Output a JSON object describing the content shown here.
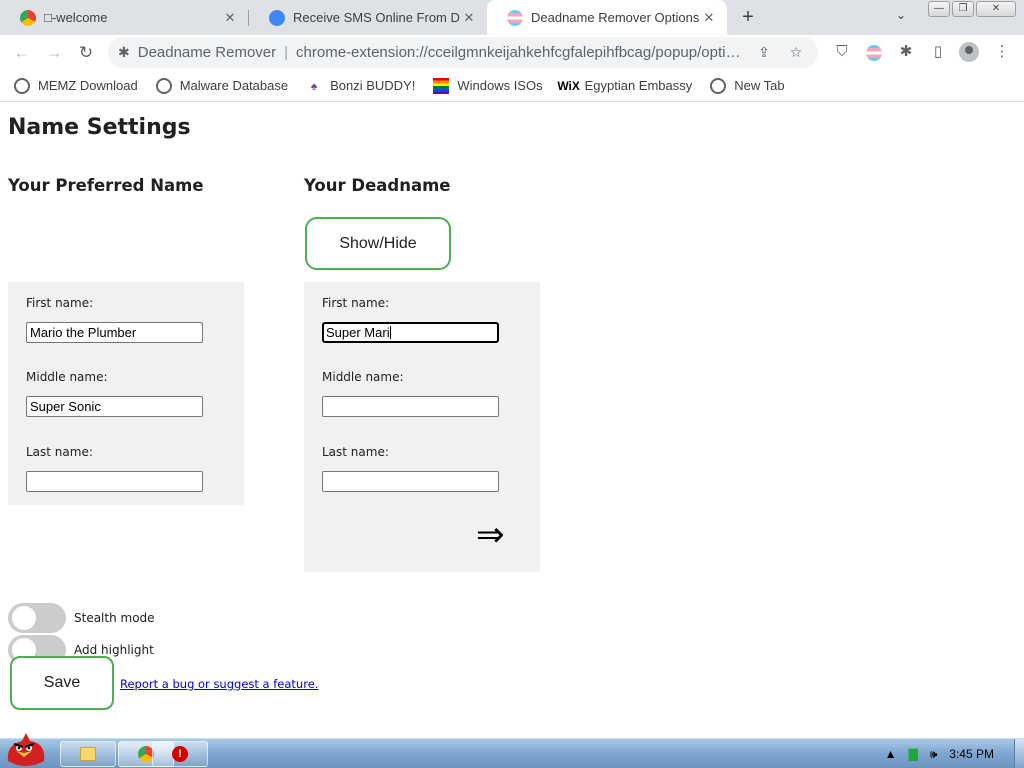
{
  "browser": {
    "tabs": [
      {
        "title": "□-welcome",
        "favicon": "chrome-red-icon",
        "active": false
      },
      {
        "title": "Receive SMS Online From DISC",
        "favicon": "sms-icon",
        "active": false
      },
      {
        "title": "Deadname Remover Options",
        "favicon": "trans-flag-icon",
        "active": true
      }
    ],
    "omnibox": {
      "extension_name": "Deadname Remover",
      "url": "chrome-extension://cceilgmnkeijahkehfcgfalepihfbcag/popup/options.html"
    },
    "bookmarks": [
      {
        "label": "MEMZ Download",
        "icon": "globe-icon"
      },
      {
        "label": "Malware Database",
        "icon": "globe-icon"
      },
      {
        "label": "Bonzi BUDDY!",
        "icon": "bonzi-icon"
      },
      {
        "label": "Windows ISOs",
        "icon": "rainbow-flag-icon"
      },
      {
        "label": "Egyptian Embassy",
        "icon": "wix-icon"
      },
      {
        "label": "New Tab",
        "icon": "globe-icon"
      }
    ]
  },
  "page": {
    "title": "Name Settings",
    "preferred": {
      "heading": "Your Preferred Name",
      "first_label": "First name:",
      "first_value": "Mario the Plumber",
      "middle_label": "Middle name:",
      "middle_value": "Super Sonic",
      "last_label": "Last name:",
      "last_value": ""
    },
    "deadname": {
      "heading": "Your Deadname",
      "show_hide_label": "Show/Hide",
      "first_label": "First name:",
      "first_value": "Super Mari",
      "middle_label": "Middle name:",
      "middle_value": "",
      "last_label": "Last name:",
      "last_value": "",
      "arrow": "⇒"
    },
    "toggles": [
      {
        "label": "Stealth mode",
        "checked": false
      },
      {
        "label": "Add highlight",
        "checked": false
      }
    ],
    "save_label": "Save",
    "report_link": "Report a bug or suggest a feature."
  },
  "taskbar": {
    "clock": "3:45 PM"
  }
}
